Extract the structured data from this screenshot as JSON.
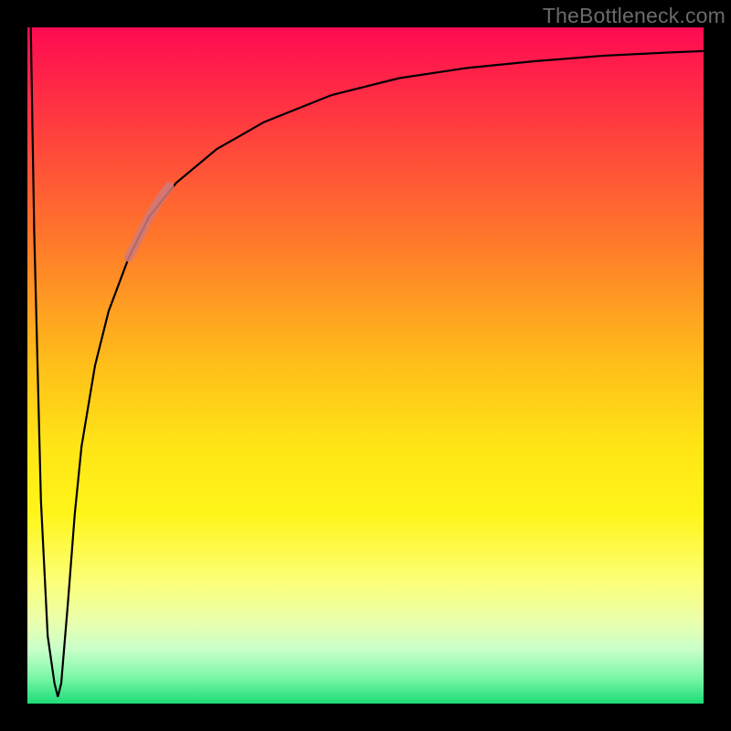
{
  "watermark": "TheBottleneck.com",
  "colors": {
    "frame": "#000000",
    "curve": "#000000",
    "highlight": "#d07a7a",
    "gradient_stops": [
      "#ff0a52",
      "#ff3e3e",
      "#ff7a2a",
      "#ffbf1a",
      "#ffe516",
      "#fff51a",
      "#fcff79",
      "#e9ffad",
      "#c9ffca",
      "#7ef7a9",
      "#1ddc77"
    ]
  },
  "chart_data": {
    "type": "line",
    "title": "",
    "xlabel": "",
    "ylabel": "",
    "xlim": [
      0,
      100
    ],
    "ylim": [
      0,
      100
    ],
    "grid": false,
    "legend": false,
    "series": [
      {
        "name": "curve",
        "x": [
          0.5,
          1,
          2,
          3,
          4,
          4.5,
          5,
          6,
          7,
          8,
          10,
          12,
          15,
          18,
          22,
          28,
          35,
          45,
          55,
          65,
          75,
          85,
          95,
          100
        ],
        "y": [
          100,
          70,
          30,
          10,
          3,
          1,
          3,
          15,
          28,
          38,
          50,
          58,
          66,
          72,
          77,
          82,
          86,
          90,
          92.5,
          94,
          95,
          95.8,
          96.3,
          96.5
        ]
      },
      {
        "name": "highlight-segment",
        "x": [
          15,
          16.5,
          18,
          19.5,
          21
        ],
        "y": [
          66,
          69,
          72,
          74.5,
          76.5
        ]
      }
    ],
    "annotations": []
  }
}
